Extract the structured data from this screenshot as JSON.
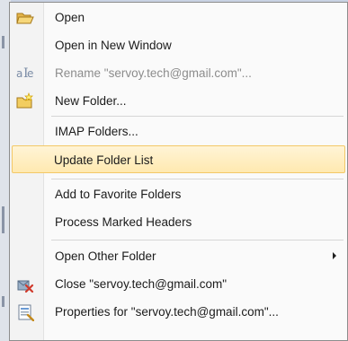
{
  "context_menu": {
    "items": [
      {
        "label": "Open",
        "icon": "open-folder-icon",
        "enabled": true
      },
      {
        "label": "Open in New Window",
        "icon": "",
        "enabled": true
      },
      {
        "label": "Rename \"servoy.tech@gmail.com\"...",
        "icon": "rename-icon",
        "enabled": false
      },
      {
        "label": "New Folder...",
        "icon": "new-folder-icon",
        "enabled": true
      },
      {
        "label": "IMAP Folders...",
        "icon": "",
        "enabled": true
      },
      {
        "label": "Update Folder List",
        "icon": "",
        "enabled": true,
        "highlighted": true
      },
      {
        "label": "Add to Favorite Folders",
        "icon": "",
        "enabled": true
      },
      {
        "label": "Process Marked Headers",
        "icon": "",
        "enabled": true
      },
      {
        "label": "Open Other Folder",
        "icon": "",
        "enabled": true,
        "submenu": true
      },
      {
        "label": "Close \"servoy.tech@gmail.com\"",
        "icon": "close-mailbox-icon",
        "enabled": true
      },
      {
        "label": "Properties for \"servoy.tech@gmail.com\"...",
        "icon": "properties-icon",
        "enabled": true
      }
    ]
  },
  "colors": {
    "highlight_fill": "#ffe9b0",
    "highlight_border": "#f3c867",
    "disabled_text": "#8c8c8c"
  }
}
